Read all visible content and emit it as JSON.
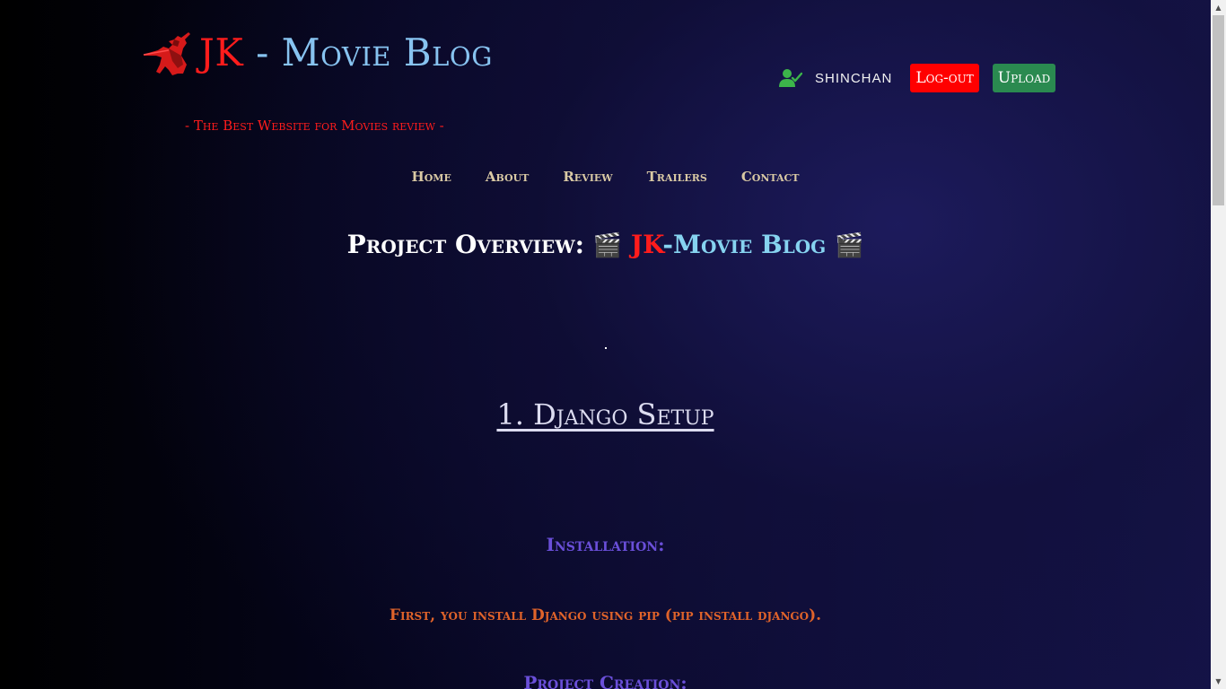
{
  "header": {
    "logo_jk": "JK",
    "logo_rest": " - Movie Blog",
    "tagline": "- The Best Website for Movies review -",
    "username": "SHINCHAN",
    "logout_label": "Log-out",
    "upload_label": "Upload"
  },
  "nav": {
    "items": [
      {
        "label": "Home"
      },
      {
        "label": "About"
      },
      {
        "label": "Review"
      },
      {
        "label": "Trailers"
      },
      {
        "label": "Contact"
      }
    ]
  },
  "main": {
    "overview_prefix": "Project Overview:",
    "clapper": "🎬",
    "overview_jk": "JK",
    "overview_rest": "-Movie Blog",
    "section_title": "1. Django Setup",
    "sub1": "Installation:",
    "para1": "First, you install Django using pip (pip install django).",
    "sub2": "Project Creation:"
  },
  "colors": {
    "brand_red": "#ff1c1c",
    "brand_blue": "#87c3f0",
    "logout_bg": "#ff0000",
    "upload_bg": "#2a8a50",
    "nav_text": "#d9c9a4",
    "subheading": "#6a4fd9",
    "paragraph": "#e0632a"
  },
  "icons": {
    "logo": "samurai-warrior-icon",
    "user": "user-check-icon",
    "clapper": "clapperboard-icon"
  }
}
